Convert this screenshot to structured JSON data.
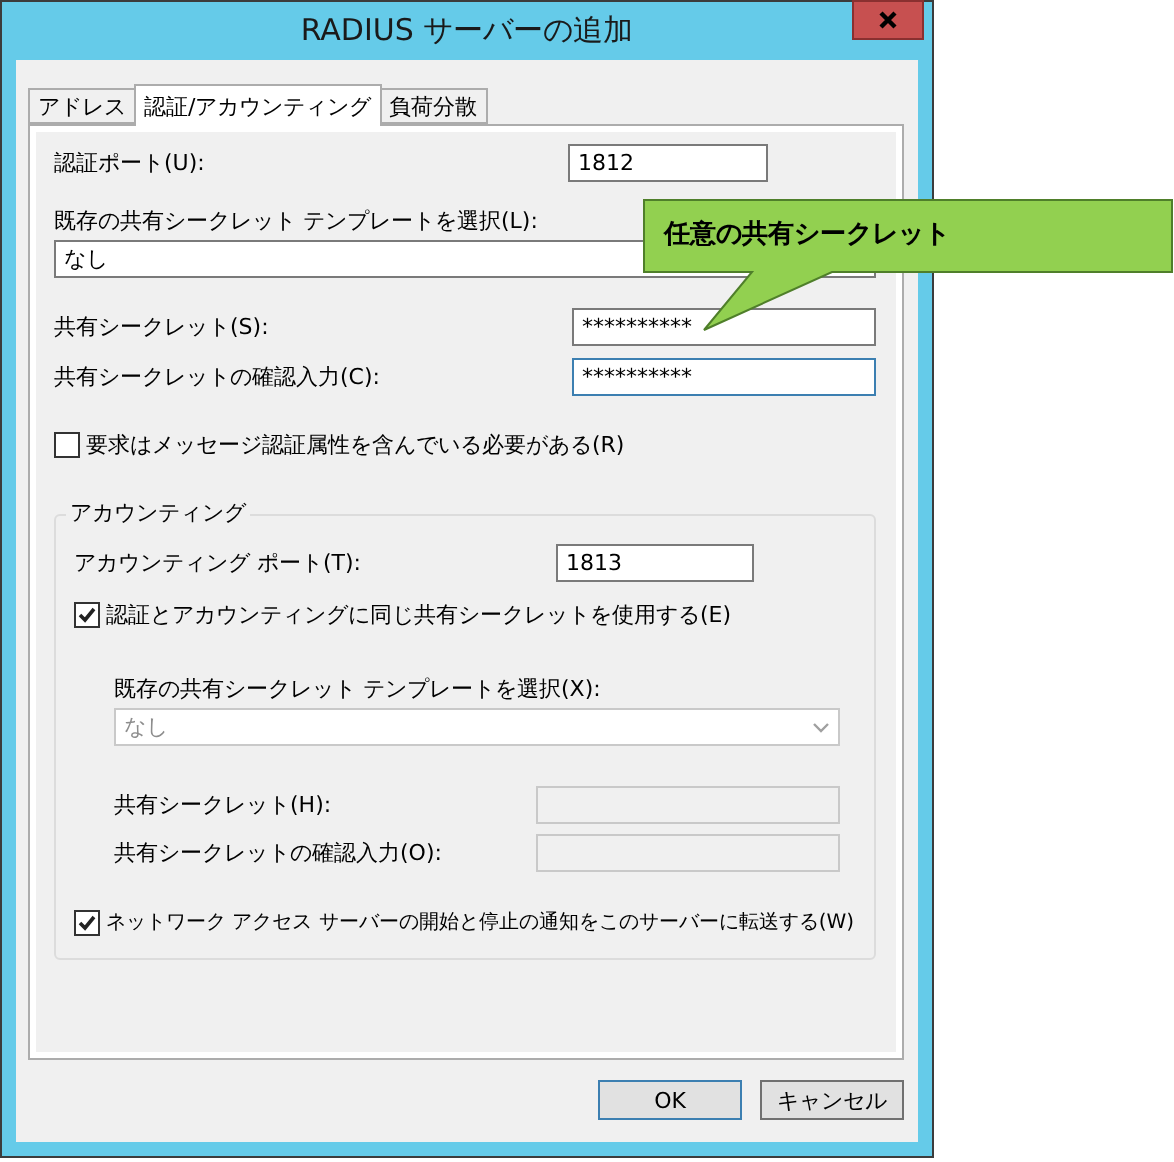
{
  "window": {
    "title": "RADIUS サーバーの追加"
  },
  "tabs": [
    {
      "label": "アドレス",
      "selected": false
    },
    {
      "label": "認証/アカウンティング",
      "selected": true
    },
    {
      "label": "負荷分散",
      "selected": false
    }
  ],
  "authentication": {
    "port": {
      "label": "認証ポート(U):",
      "value": "1812"
    },
    "template": {
      "label": "既存の共有シークレット テンプレートを選択(L):",
      "value": "なし"
    },
    "secret": {
      "label": "共有シークレット(S):",
      "value": "**********",
      "focused": false
    },
    "confirm": {
      "label": "共有シークレットの確認入力(C):",
      "value": "**********",
      "focused": true
    },
    "message_auth": {
      "label": "要求はメッセージ認証属性を含んでいる必要がある(R)",
      "checked": false
    }
  },
  "accounting": {
    "title": "アカウンティング",
    "port": {
      "label": "アカウンティング ポート(T):",
      "value": "1813"
    },
    "same_secret": {
      "label": "認証とアカウンティングに同じ共有シークレットを使用する(E)",
      "checked": true
    },
    "template": {
      "label": "既存の共有シークレット テンプレートを選択(X):",
      "value": "なし",
      "disabled": true
    },
    "secret": {
      "label": "共有シークレット(H):",
      "disabled": true
    },
    "confirm": {
      "label": "共有シークレットの確認入力(O):",
      "disabled": true
    },
    "forward": {
      "label": "ネットワーク アクセス サーバーの開始と停止の通知をこのサーバーに転送する(W)",
      "checked": true
    }
  },
  "buttons": [
    {
      "label": "OK",
      "default": true
    },
    {
      "label": "キャンセル",
      "default": false
    }
  ],
  "callout": {
    "text": "任意の共有シークレット"
  }
}
